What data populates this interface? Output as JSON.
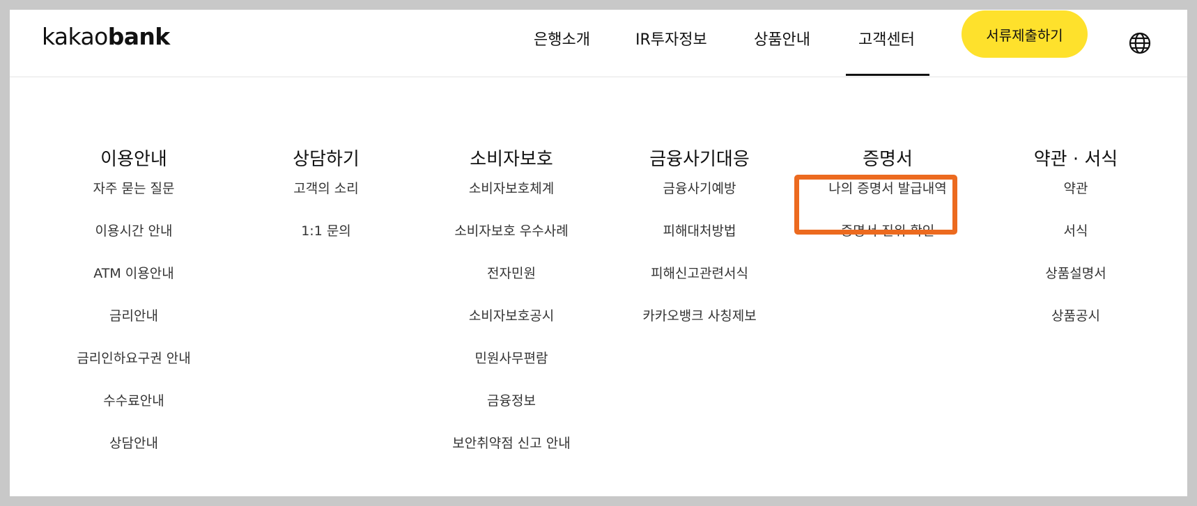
{
  "header": {
    "logo_light": "kakao",
    "logo_bold": "bank",
    "nav": [
      "은행소개",
      "IR투자정보",
      "상품안내",
      "고객센터"
    ],
    "active_nav": "고객센터",
    "cta_label": "서류제출하기",
    "cta_color": "#fee12c",
    "globe_icon": "globe-icon"
  },
  "menu": {
    "columns": [
      {
        "title": "이용안내",
        "links": [
          "자주 묻는 질문",
          "이용시간 안내",
          "ATM 이용안내",
          "금리안내",
          "금리인하요구권 안내",
          "수수료안내",
          "상담안내"
        ]
      },
      {
        "title": "상담하기",
        "links": [
          "고객의 소리",
          "1:1 문의"
        ]
      },
      {
        "title": "소비자보호",
        "links": [
          "소비자보호체계",
          "소비자보호 우수사례",
          "전자민원",
          "소비자보호공시",
          "민원사무편람",
          "금융정보",
          "보안취약점 신고 안내"
        ]
      },
      {
        "title": "금융사기대응",
        "links": [
          "금융사기예방",
          "피해대처방법",
          "피해신고관련서식",
          "카카오뱅크 사칭제보"
        ]
      },
      {
        "title": "증명서",
        "links": [
          "나의 증명서 발급내역",
          "증명서 진위 확인"
        ]
      },
      {
        "title": "약관 · 서식",
        "links": [
          "약관",
          "서식",
          "상품설명서",
          "상품공시"
        ]
      }
    ],
    "highlight_color": "#ec6a1f"
  }
}
